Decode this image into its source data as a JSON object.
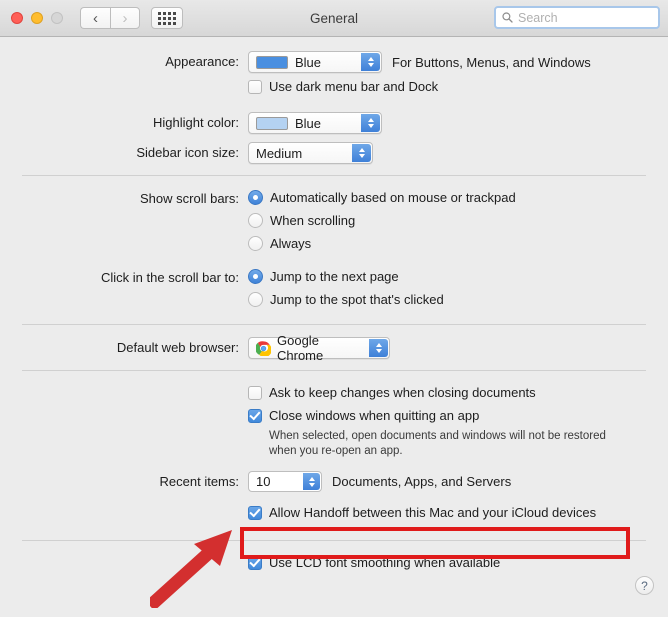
{
  "window": {
    "title": "General",
    "traffic_lights": [
      "close-red",
      "minimize-yellow",
      "zoom-disabled"
    ],
    "back_label": "‹",
    "forward_label": "›",
    "grid_icon": "show-all-grid-icon"
  },
  "search": {
    "placeholder": "Search",
    "value": "",
    "icon": "search-icon"
  },
  "appearance": {
    "label": "Appearance:",
    "value": "Blue",
    "swatch_color": "#4a8fe0",
    "hint": "For Buttons, Menus, and Windows",
    "dark_menu_checkbox": {
      "label": "Use dark menu bar and Dock",
      "checked": false
    }
  },
  "highlight": {
    "label": "Highlight color:",
    "value": "Blue",
    "swatch_color": "#b4d2f2"
  },
  "sidebar_icon": {
    "label": "Sidebar icon size:",
    "value": "Medium"
  },
  "scroll_bars": {
    "label": "Show scroll bars:",
    "options": [
      {
        "label": "Automatically based on mouse or trackpad",
        "selected": true
      },
      {
        "label": "When scrolling",
        "selected": false
      },
      {
        "label": "Always",
        "selected": false
      }
    ]
  },
  "scroll_click": {
    "label": "Click in the scroll bar to:",
    "options": [
      {
        "label": "Jump to the next page",
        "selected": true
      },
      {
        "label": "Jump to the spot that's clicked",
        "selected": false
      }
    ]
  },
  "browser": {
    "label": "Default web browser:",
    "value": "Google Chrome",
    "icon": "google-chrome-icon"
  },
  "documents": {
    "ask_keep_changes": {
      "label": "Ask to keep changes when closing documents",
      "checked": false
    },
    "close_windows": {
      "label": "Close windows when quitting an app",
      "checked": true
    },
    "close_windows_note": "When selected, open documents and windows will not be restored when you re-open an app."
  },
  "recent_items": {
    "label": "Recent items:",
    "value": "10",
    "hint": "Documents, Apps, and Servers"
  },
  "handoff": {
    "label": "Allow Handoff between this Mac and your iCloud devices",
    "checked": true,
    "highlight_color": "#e01b1b"
  },
  "lcd_smoothing": {
    "label": "Use LCD font smoothing when available",
    "checked": true
  },
  "help": {
    "label": "?"
  }
}
